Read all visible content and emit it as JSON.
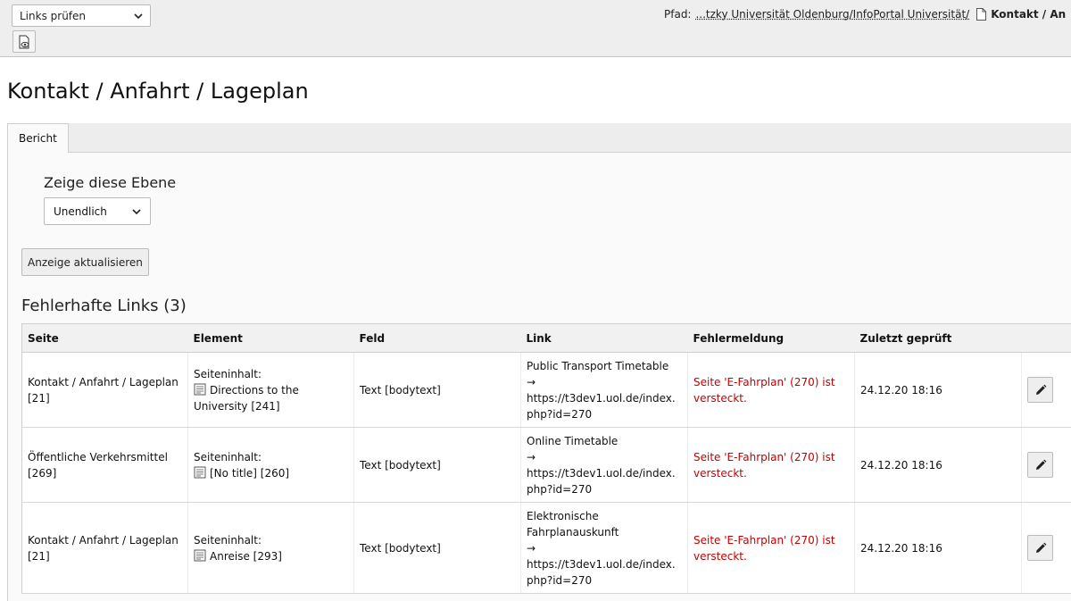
{
  "header": {
    "module_select": "Links prüfen",
    "path_label": "Pfad:",
    "path_link": "...tzky Universität Oldenburg/InfoPortal Universität/",
    "path_current": "Kontakt / An"
  },
  "page": {
    "title": "Kontakt / Anfahrt / Lageplan"
  },
  "tabs": [
    {
      "label": "Bericht"
    }
  ],
  "filter": {
    "label": "Zeige diese Ebene",
    "selected": "Unendlich",
    "refresh_label": "Anzeige aktualisieren"
  },
  "section": {
    "title": "Fehlerhafte Links (3)"
  },
  "table": {
    "columns": [
      "Seite",
      "Element",
      "Feld",
      "Link",
      "Fehlermeldung",
      "Zuletzt geprüft"
    ],
    "rows": [
      {
        "seite": "Kontakt / Anfahrt / Lageplan [21]",
        "element_prefix": "Seiteninhalt:",
        "element": "Directions to the University [241]",
        "feld": "Text [bodytext]",
        "link_text": "Public Transport Timetable",
        "arrow": "→",
        "link_url": "https://t3dev1.uol.de/index.php?id=270",
        "error": "Seite 'E-Fahrplan' (270) ist versteckt.",
        "checked": "24.12.20 18:16"
      },
      {
        "seite": "Öffentliche Verkehrsmittel [269]",
        "element_prefix": "Seiteninhalt:",
        "element": "[No title] [260]",
        "feld": "Text [bodytext]",
        "link_text": "Online Timetable",
        "arrow": "→",
        "link_url": "https://t3dev1.uol.de/index.php?id=270",
        "error": "Seite 'E-Fahrplan' (270) ist versteckt.",
        "checked": "24.12.20 18:16"
      },
      {
        "seite": "Kontakt / Anfahrt / Lageplan [21]",
        "element_prefix": "Seiteninhalt:",
        "element": "Anreise [293]",
        "feld": "Text [bodytext]",
        "link_text": "Elektronische Fahrplanauskunft",
        "arrow": "→",
        "link_url": "https://t3dev1.uol.de/index.php?id=270",
        "error": "Seite 'E-Fahrplan' (270) ist versteckt.",
        "checked": "24.12.20 18:16"
      }
    ]
  },
  "colors": {
    "error": "#c30000",
    "header_bg": "#eeeeee"
  },
  "icons": {
    "view": "view-page-icon",
    "edit": "pencil-icon",
    "content": "content-element-icon",
    "page": "page-icon"
  }
}
